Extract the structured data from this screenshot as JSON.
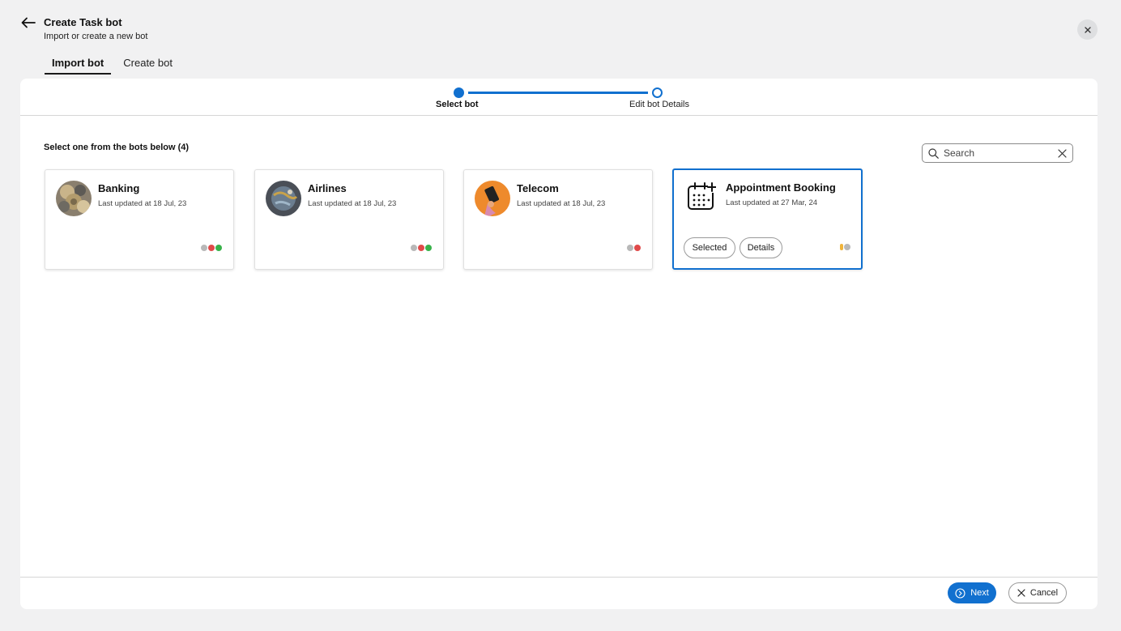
{
  "header": {
    "title": "Create Task bot",
    "subtitle": "Import or create a new bot"
  },
  "tabs": [
    {
      "label": "Import bot",
      "active": true
    },
    {
      "label": "Create bot",
      "active": false
    }
  ],
  "stepper": {
    "steps": [
      {
        "label": "Select bot",
        "state": "current"
      },
      {
        "label": "Edit bot Details",
        "state": "upcoming"
      }
    ]
  },
  "list": {
    "heading": "Select one from the bots below (4)"
  },
  "search": {
    "placeholder": "Search",
    "value": ""
  },
  "bots": [
    {
      "name": "Banking",
      "updated": "Last updated at 18 Jul, 23",
      "selected": false
    },
    {
      "name": "Airlines",
      "updated": "Last updated at 18 Jul, 23",
      "selected": false
    },
    {
      "name": "Telecom",
      "updated": "Last updated at 18 Jul, 23",
      "selected": false
    },
    {
      "name": "Appointment Booking",
      "updated": "Last updated at 27 Mar, 24",
      "selected": true,
      "selected_label": "Selected",
      "details_label": "Details"
    }
  ],
  "footer": {
    "next_label": "Next",
    "cancel_label": "Cancel"
  },
  "colors": {
    "accent": "#1170cf",
    "background": "#f1f1f2",
    "panel": "#ffffff"
  }
}
